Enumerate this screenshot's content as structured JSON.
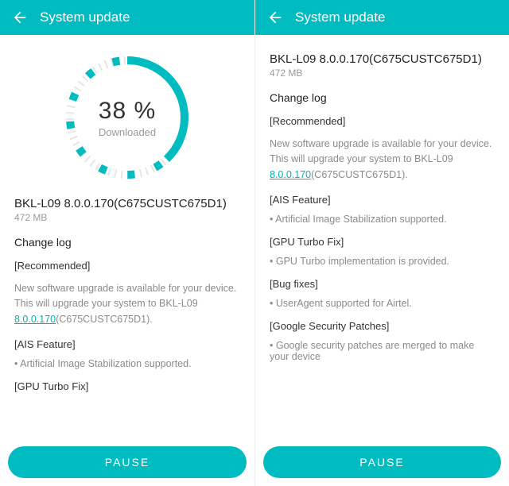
{
  "app_title": "System update",
  "colors": {
    "accent": "#00bcc0",
    "muted": "#9a9a9a",
    "link": "#00b2b5"
  },
  "left": {
    "progress_percent": 38,
    "progress_label": "38 %",
    "progress_status": "Downloaded",
    "version_line": "BKL-L09 8.0.0.170(C675CUSTC675D1)",
    "size": "472 MB",
    "changelog_heading": "Change log",
    "recommended_heading": "[Recommended]",
    "recommended_body_pre": "New software upgrade is available for your device. This will upgrade your system to BKL-L09 ",
    "recommended_body_link": "8.0.0.170",
    "recommended_body_post": "(C675CUSTC675D1).",
    "ais_heading": "[AIS Feature]",
    "ais_bullet": "Artificial Image Stabilization supported.",
    "gpu_heading": "[GPU Turbo Fix]",
    "button": "PAUSE"
  },
  "right": {
    "version_line": "BKL-L09 8.0.0.170(C675CUSTC675D1)",
    "size": "472 MB",
    "changelog_heading": "Change log",
    "recommended_heading": "[Recommended]",
    "recommended_body_pre": "New software upgrade is available for your device. This will upgrade your system to BKL-L09 ",
    "recommended_body_link": "8.0.0.170",
    "recommended_body_post": "(C675CUSTC675D1).",
    "ais_heading": "[AIS Feature]",
    "ais_bullet": "Artificial Image Stabilization supported.",
    "gpu_heading": "[GPU Turbo Fix]",
    "gpu_bullet": "GPU Turbo implementation is provided.",
    "bug_heading": "[Bug fixes]",
    "bug_bullet": "UserAgent supported for Airtel.",
    "sec_heading": "[Google Security Patches]",
    "sec_bullet": "Google security patches are merged to make your device",
    "button": "PAUSE"
  }
}
